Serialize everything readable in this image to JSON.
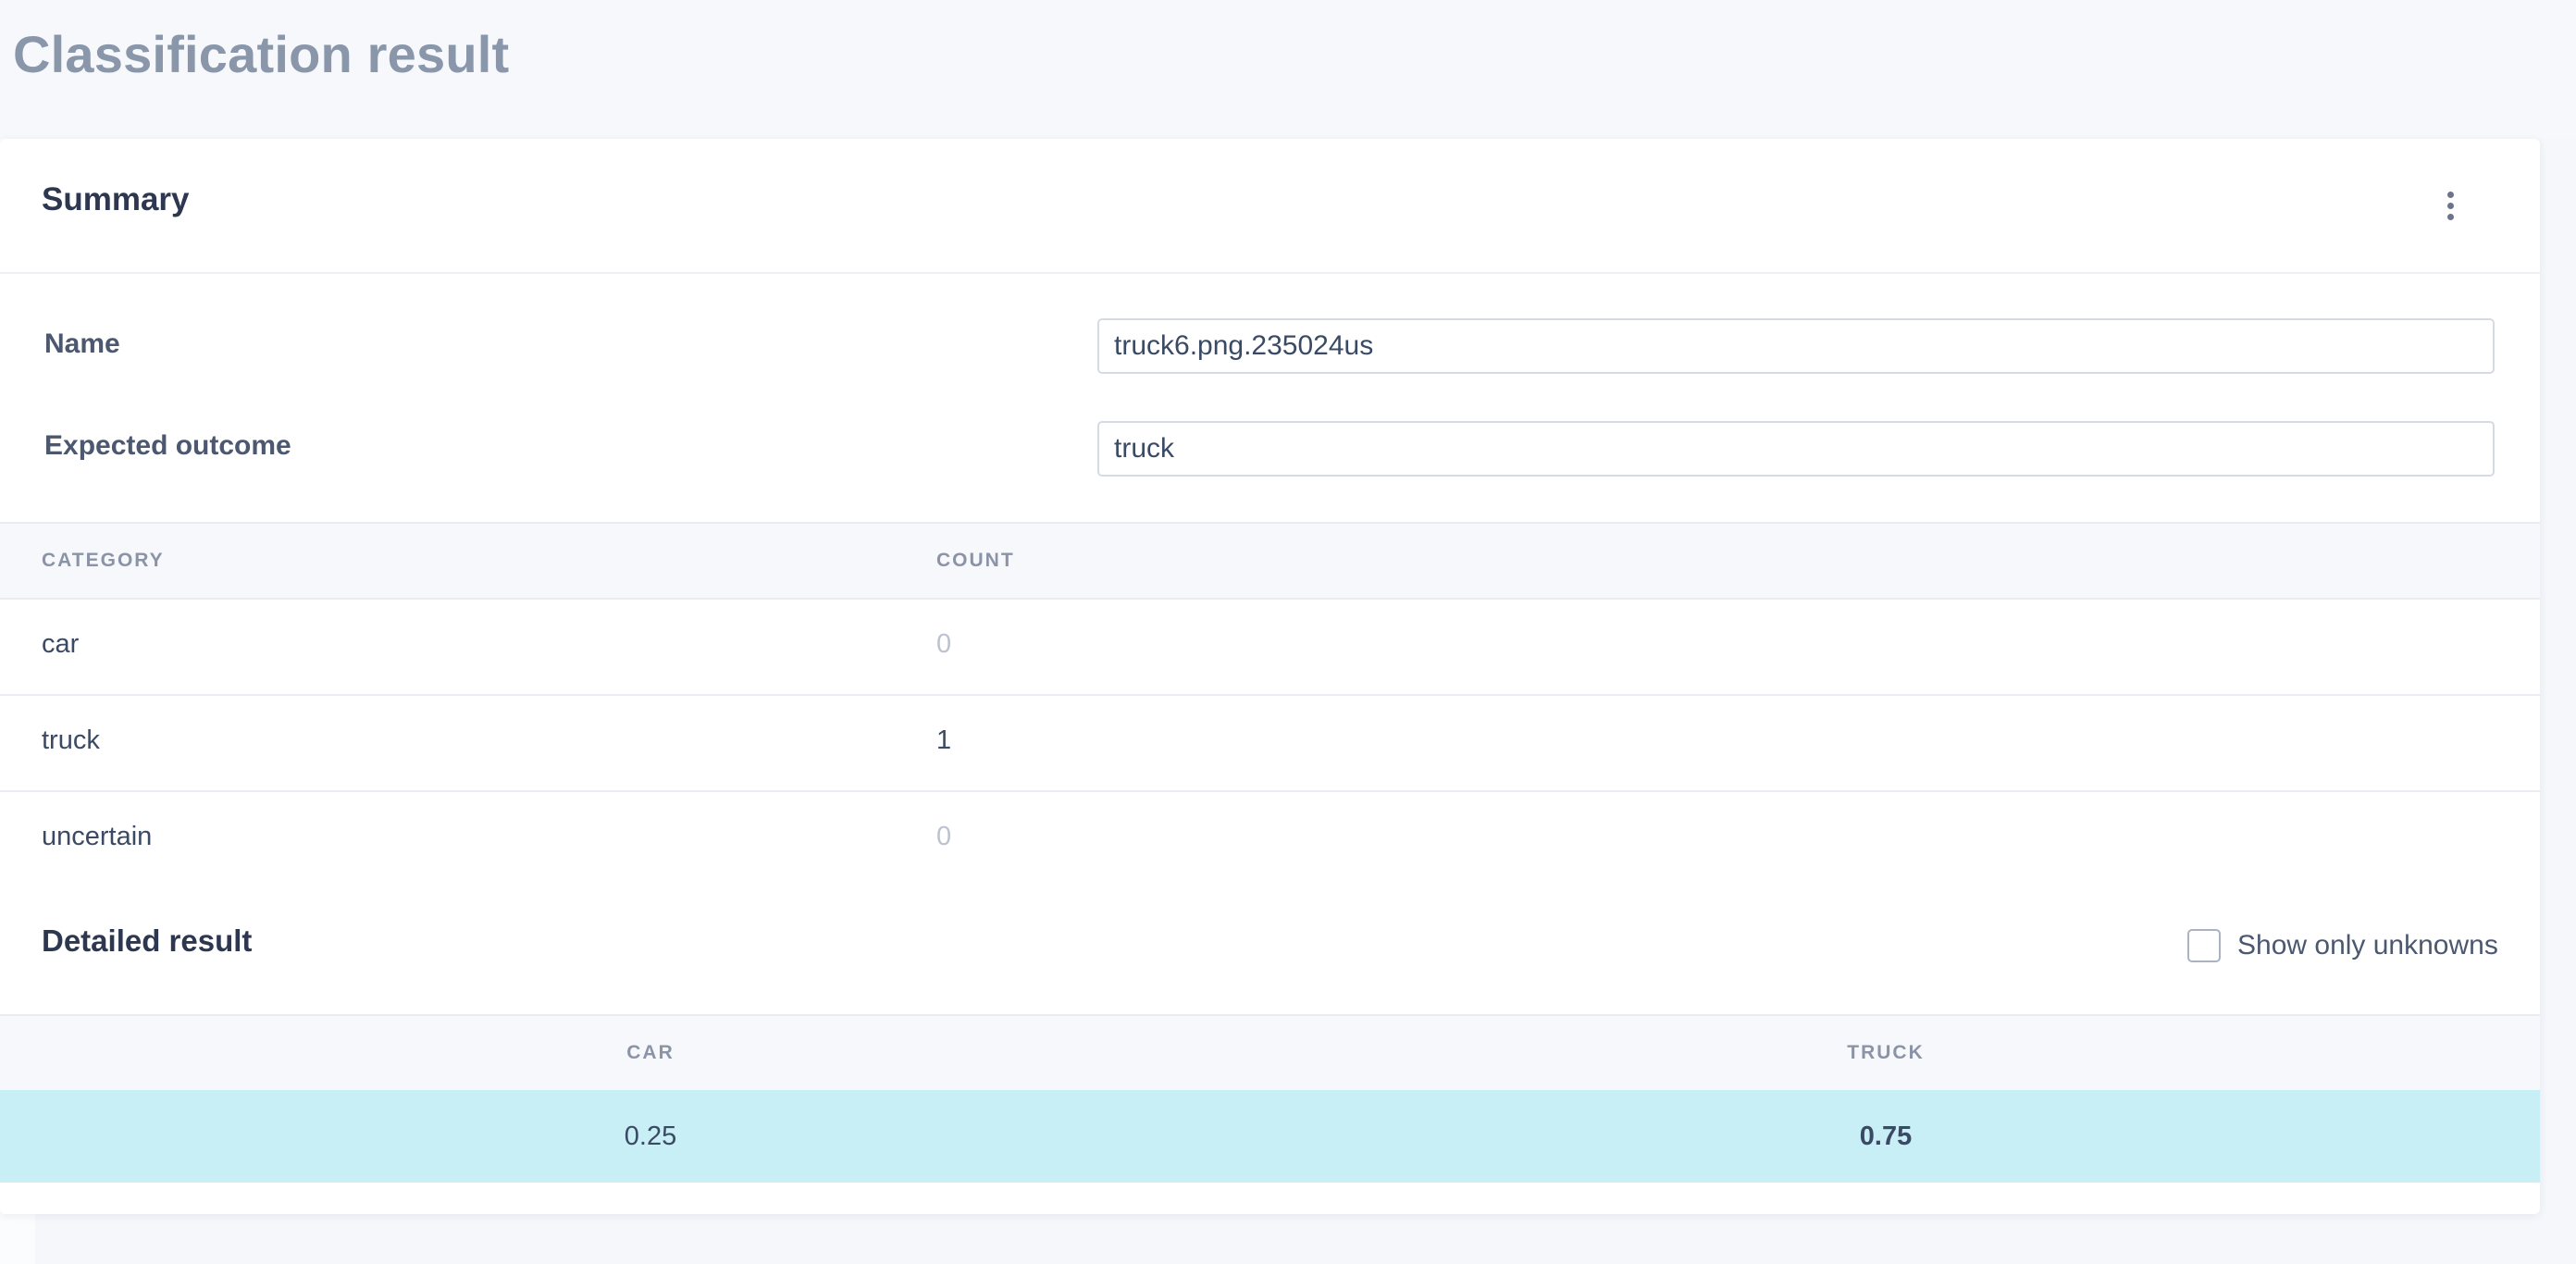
{
  "page": {
    "title": "Classification result"
  },
  "summary": {
    "title": "Summary",
    "menu_icon": "kebab-menu-icon",
    "name_label": "Name",
    "name_value": "truck6.png.235024us",
    "expected_label": "Expected outcome",
    "expected_value": "truck"
  },
  "category_table": {
    "headers": [
      "CATEGORY",
      "COUNT"
    ],
    "rows": [
      {
        "category": "car",
        "count": "0"
      },
      {
        "category": "truck",
        "count": "1"
      },
      {
        "category": "uncertain",
        "count": "0"
      }
    ]
  },
  "detailed": {
    "title": "Detailed result",
    "show_unknowns_label": "Show only unknowns",
    "show_unknowns_checked": false,
    "headers": [
      "CAR",
      "TRUCK"
    ],
    "row": [
      "0.25",
      "0.75"
    ],
    "highlight_color": "#c8eef6"
  }
}
